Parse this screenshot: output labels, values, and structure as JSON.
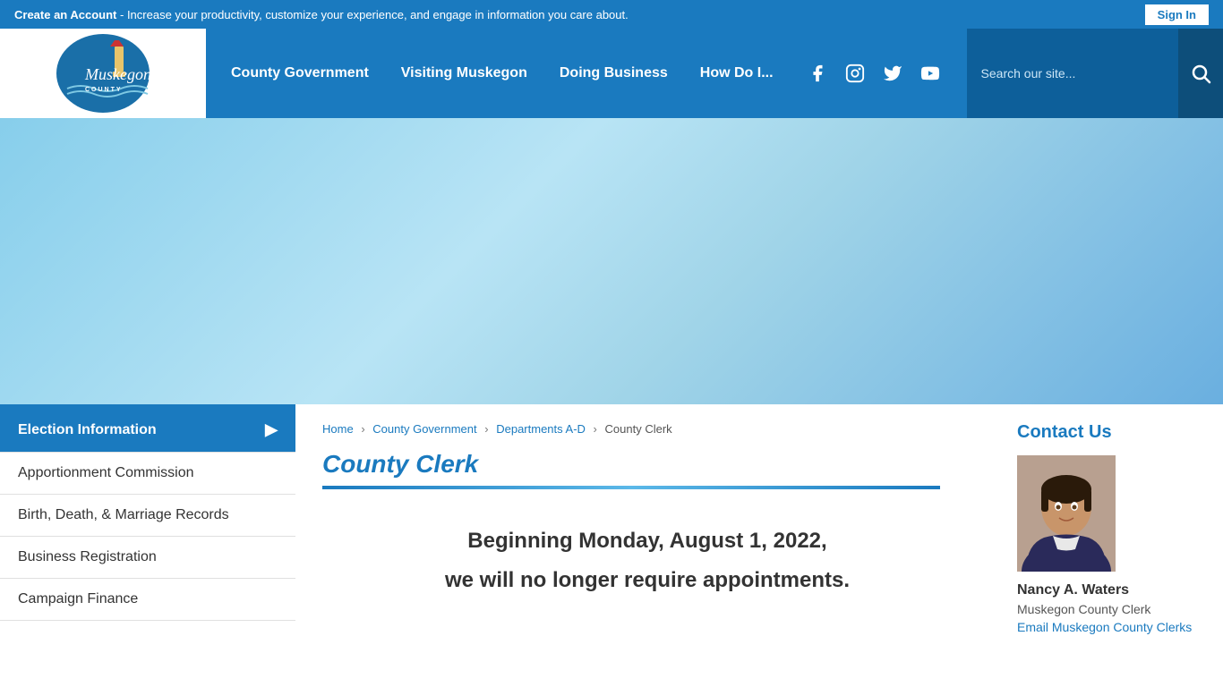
{
  "top_banner": {
    "create_account_label": "Create an Account",
    "create_account_desc": " - Increase your productivity, customize your experience, and engage in information you care about.",
    "sign_in_label": "Sign In"
  },
  "header": {
    "logo": {
      "text": "Muskegon",
      "county_label": "COUNTY"
    },
    "nav": [
      {
        "label": "County Government",
        "id": "county-government"
      },
      {
        "label": "Visiting Muskegon",
        "id": "visiting-muskegon"
      },
      {
        "label": "Doing Business",
        "id": "doing-business"
      },
      {
        "label": "How Do I...",
        "id": "how-do-i"
      }
    ],
    "search_placeholder": "Search our site..."
  },
  "sidebar": {
    "items": [
      {
        "label": "Election Information",
        "active": true,
        "has_arrow": true
      },
      {
        "label": "Apportionment Commission",
        "active": false,
        "has_arrow": false
      },
      {
        "label": "Birth, Death, & Marriage Records",
        "active": false,
        "has_arrow": false
      },
      {
        "label": "Business Registration",
        "active": false,
        "has_arrow": false
      },
      {
        "label": "Campaign Finance",
        "active": false,
        "has_arrow": false
      }
    ]
  },
  "breadcrumb": {
    "home": "Home",
    "county_gov": "County Government",
    "departments": "Departments A-D",
    "current": "County Clerk"
  },
  "main": {
    "page_title": "County Clerk",
    "announcement_line1": "Beginning Monday, August 1, 2022,",
    "announcement_line2": "we will no longer require appointments."
  },
  "contact": {
    "section_title": "Contact Us",
    "name": "Nancy A. Waters",
    "title": "Muskegon County Clerk",
    "email_label": "Email Muskegon County Clerks"
  }
}
